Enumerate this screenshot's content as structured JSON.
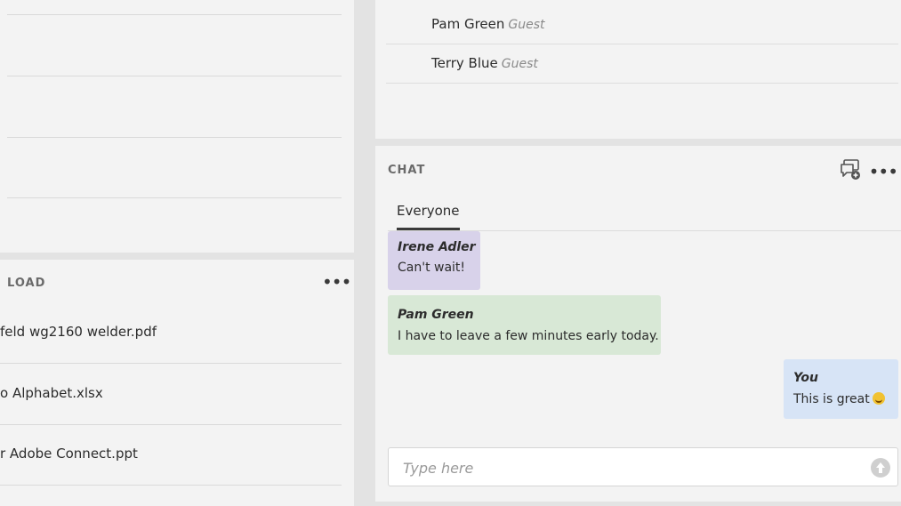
{
  "files_pod": {
    "title": "LOAD",
    "files": [
      {
        "name": "feld wg2160 welder.pdf"
      },
      {
        "name": "o Alphabet.xlsx"
      },
      {
        "name": "r Adobe Connect.ppt"
      }
    ]
  },
  "attendees": [
    {
      "name": "Pam Green",
      "role": "Guest"
    },
    {
      "name": "Terry Blue",
      "role": "Guest"
    }
  ],
  "chat": {
    "title": "CHAT",
    "tab": "Everyone",
    "messages": [
      {
        "author": "Irene Adler",
        "text": "Can't wait!",
        "color": "#d8d2ea"
      },
      {
        "author": "Pam Green",
        "text": "I have to leave a few minutes early today.",
        "color": "#d8e8d6"
      },
      {
        "author": "You",
        "text": "This is great",
        "color": "#d7e4f6"
      }
    ],
    "input_placeholder": "Type here",
    "icons": {
      "new_chat": "new-chat-icon",
      "more": "more-options-icon",
      "send": "send-icon"
    }
  }
}
